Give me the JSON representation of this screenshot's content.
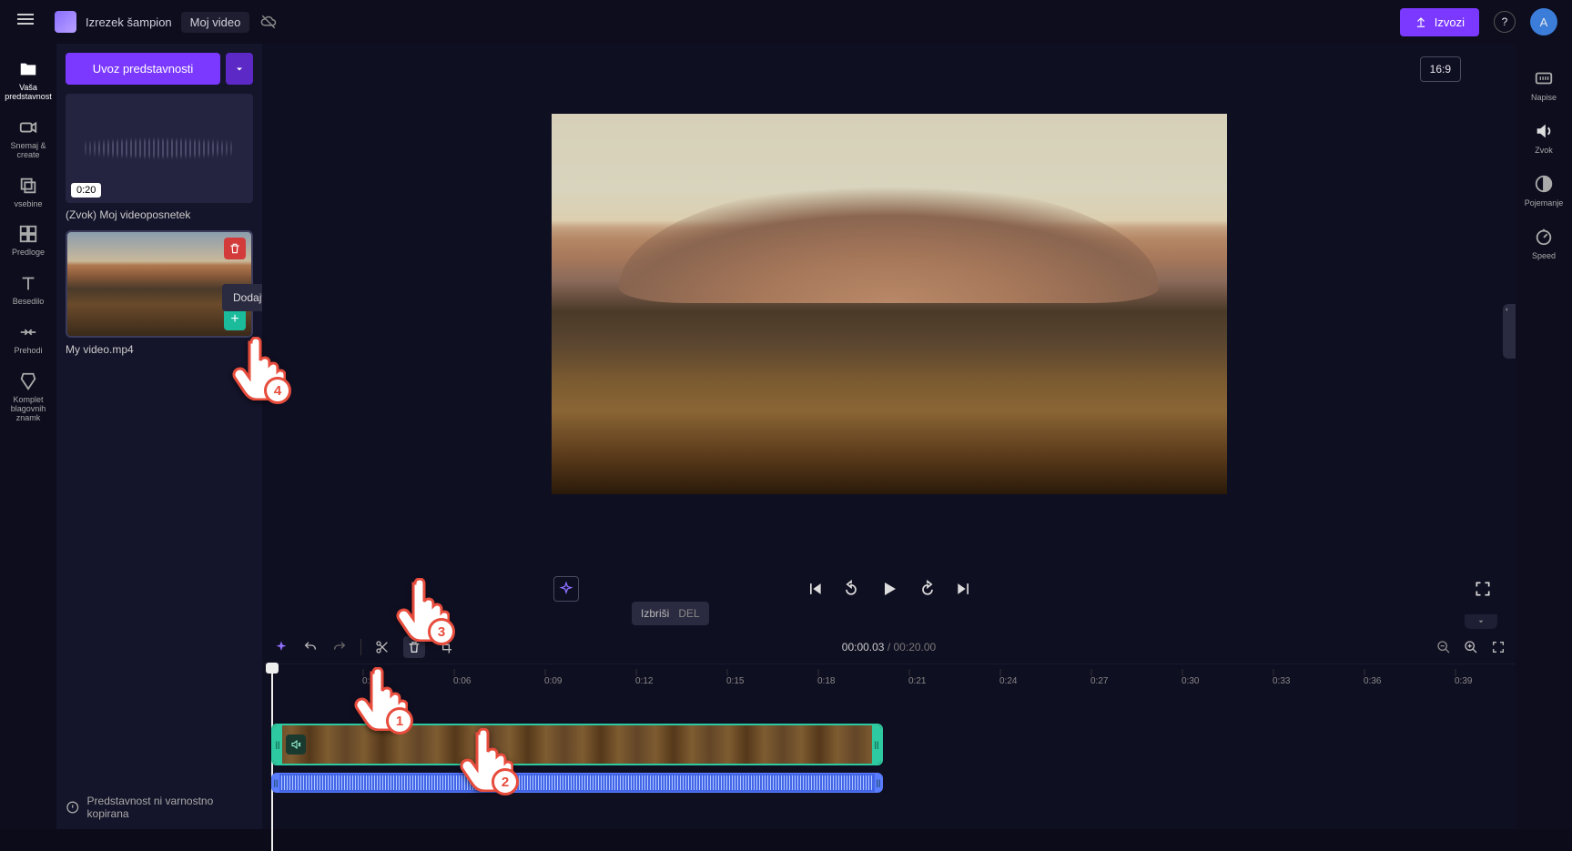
{
  "topbar": {
    "app_name": "Izrezek šampion",
    "project_name": "Moj video",
    "export_label": "Izvozi",
    "avatar_letter": "A",
    "aspect_label": "16:9"
  },
  "left_rail": [
    {
      "label": "Vaša predstavnost",
      "icon": "folder-icon"
    },
    {
      "label": "Snemaj & create",
      "icon": "camera-icon"
    },
    {
      "label": "vsebine",
      "icon": "layers-icon"
    },
    {
      "label": "Predloge",
      "icon": "grid-icon"
    },
    {
      "label": "Besedilo",
      "icon": "text-icon"
    },
    {
      "label": "Prehodi",
      "icon": "transitions-icon"
    },
    {
      "label": "Komplet blagovnih znamk",
      "icon": "brandkit-icon"
    }
  ],
  "media_panel": {
    "import_label": "Uvoz predstavnosti",
    "audio": {
      "duration": "0:20",
      "name": "(Zvok) Moj videoposnetek"
    },
    "video": {
      "name": "My video.mp4"
    },
    "add_tooltip": "Dodajte na časovno premico",
    "backup_warning": "Predstavnost ni varnostno kopirana"
  },
  "playback": {
    "current": "00:00.03",
    "total": "00:20.00"
  },
  "toolbar": {
    "delete_label": "Izbriši",
    "delete_shortcut": "DEL"
  },
  "ruler_ticks": [
    "0:03",
    "0:06",
    "0:09",
    "0:12",
    "0:15",
    "0:18",
    "0:21",
    "0:24",
    "0:27",
    "0:30",
    "0:33",
    "0:36",
    "0:39"
  ],
  "right_rail": [
    {
      "label": "Napise",
      "icon": "cc-icon"
    },
    {
      "label": "Zvok",
      "icon": "volume-icon"
    },
    {
      "label": "Pojemanje",
      "icon": "fade-icon"
    },
    {
      "label": "Speed",
      "icon": "speed-icon"
    }
  ],
  "hands": {
    "1": "1",
    "2": "2",
    "3": "3",
    "4": "4"
  }
}
